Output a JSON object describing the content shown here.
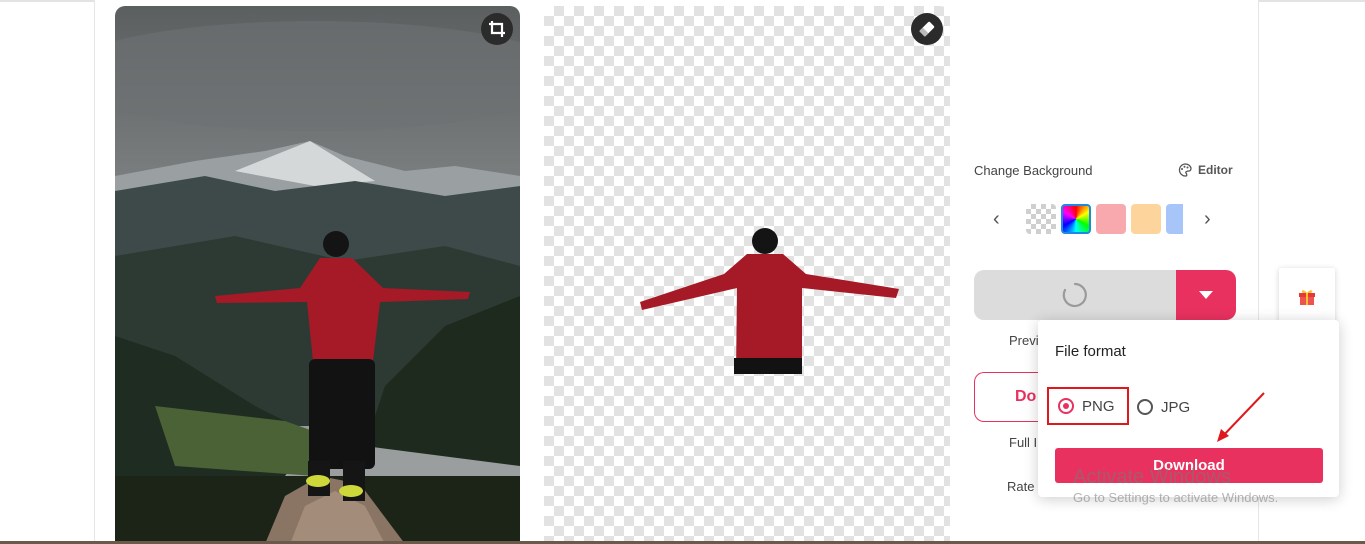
{
  "panel": {
    "change_background_label": "Change Background",
    "editor_label": "Editor",
    "prev_arrow": "‹",
    "next_arrow": "›",
    "swatches": [
      "transparent",
      "color-picker",
      "#f8a9ad",
      "#fdd59c",
      "#a7c5f9"
    ],
    "preview_label": "Previ",
    "outline_button_label": "Do",
    "full_image_label": "Full Ir",
    "rate_label": "Rate"
  },
  "popup": {
    "title": "File format",
    "options": [
      {
        "label": "PNG",
        "selected": true
      },
      {
        "label": "JPG",
        "selected": false
      }
    ],
    "download_label": "Download"
  },
  "watermark": {
    "line1": "Activate Windows",
    "line2": "Go to Settings to activate Windows."
  },
  "colors": {
    "accent": "#e8315f",
    "highlight_box": "#e0171c",
    "spinner_area": "#dcdcdc"
  },
  "icons": {
    "crop": "crop-icon",
    "eraser": "eraser-icon",
    "editor": "palette-icon",
    "dropdown": "caret-down-icon",
    "gift": "gift-icon",
    "spinner": "loading-spinner-icon"
  }
}
